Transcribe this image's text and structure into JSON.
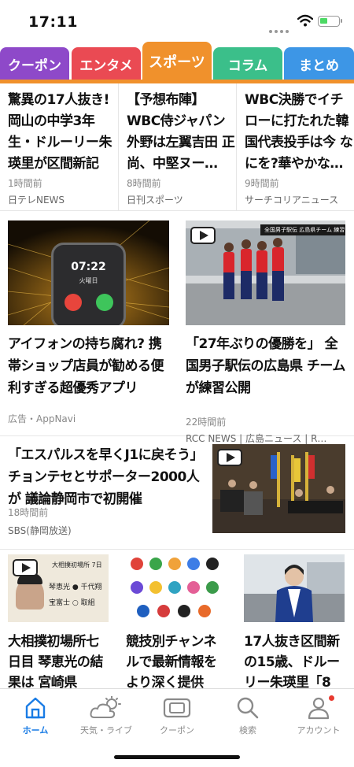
{
  "status_bar": {
    "time": "17:11"
  },
  "tabs": [
    {
      "label": "クーポン",
      "color": "#8e49c9",
      "active": false
    },
    {
      "label": "エンタメ",
      "color": "#ea4a53",
      "active": false
    },
    {
      "label": "スポーツ",
      "color": "#f0912c",
      "active": true
    },
    {
      "label": "コラム",
      "color": "#3bbf8a",
      "active": false
    },
    {
      "label": "まとめ",
      "color": "#3d96e6",
      "active": false
    }
  ],
  "accent_color": "#f0912c",
  "top_articles": [
    {
      "title": "驚異の17人抜き! 岡山の中学3年生・ドルーリー朱瑛里が区間新記録…",
      "time": "1時間前",
      "source": "日テレNEWS"
    },
    {
      "title": "【予想布陣】WBC侍ジャパン 外野は左翼吉田 正尚、中堅ヌー…",
      "time": "8時間前",
      "source": "日刊スポーツ"
    },
    {
      "title": "WBC決勝でイチローに打たれた韓国代表投手は今 なにを?華やかな…",
      "time": "9時間前",
      "source": "サーチコリアニュース"
    }
  ],
  "big_articles": [
    {
      "title": "アイフォンの持ち腐れ? 携帯ショップ店員が勧める便利すぎる超優秀アプリ",
      "time": "",
      "source": "広告・AppNavi",
      "phone_time": "07:22",
      "phone_day": "火曜日"
    },
    {
      "title": "「27年ぶりの優勝を」 全国男子駅伝の広島県 チームが練習公開",
      "time": "22時間前",
      "source": "RCC NEWS | 広島ニュース | R…",
      "caption": "全国男子駅伝 広島県チーム 練習を公"
    }
  ],
  "wide_article": {
    "title": "「エスパルスを早くJ1に戻そう」 チョンテセとサポーター2000人が 議論静岡市で初開催",
    "time": "18時間前",
    "source": "SBS(静岡放送)"
  },
  "bottom_articles": [
    {
      "title": "大相撲初場所七日目 琴恵光の結果は 宮崎県",
      "thumb_heading": "大相撲初場所 7日",
      "thumb_line1": "琴恵光 ● 千代翔",
      "thumb_line2": "宝富士 ○ 取組"
    },
    {
      "title": "競技別チャンネルで最新情報をより深く提供中。"
    },
    {
      "title": "17人抜き区間新の15歳、ドルーリー朱瑛里「8"
    }
  ],
  "bottom_nav": [
    {
      "label": "ホーム",
      "icon": "home-icon",
      "active": true
    },
    {
      "label": "天気・ライブ",
      "icon": "weather-icon",
      "active": false
    },
    {
      "label": "クーポン",
      "icon": "coupon-icon",
      "active": false
    },
    {
      "label": "検索",
      "icon": "search-icon",
      "active": false
    },
    {
      "label": "アカウント",
      "icon": "account-icon",
      "active": false
    }
  ]
}
